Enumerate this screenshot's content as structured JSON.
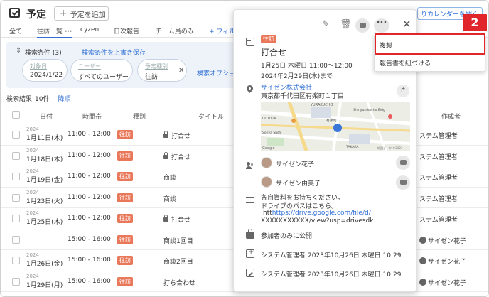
{
  "header": {
    "title": "予定",
    "add_button": "予定を追加",
    "my_calendar_button": "りカレンダーを開く"
  },
  "tabs": [
    {
      "label": "全て"
    },
    {
      "label": "往訪一覧",
      "active": true
    },
    {
      "label": "cyzen"
    },
    {
      "label": "日次報告"
    },
    {
      "label": "チーム員のみ"
    },
    {
      "label": "+ フィル"
    }
  ],
  "conditions": {
    "label": "検索条件 (3)",
    "overwrite": "検索条件を上書き保存",
    "fields": [
      {
        "label": "対象日",
        "value": "2024/1/22"
      },
      {
        "label": "ユーザー",
        "value": "すべてのユーザー"
      },
      {
        "label": "予定種別",
        "value": "往訪"
      }
    ],
    "options": "検索オプショ"
  },
  "results": {
    "label": "検索結果",
    "count": "10件",
    "order": "降順"
  },
  "table": {
    "headers": [
      "日付",
      "時間帯",
      "種別",
      "タイトル",
      "作成者"
    ],
    "rows": [
      {
        "year": "2024",
        "date": "1月11日(木)",
        "time": "11:00 - 12:00",
        "type": "往訪",
        "title": "打合せ",
        "locked": true,
        "creator": "ステム管理者"
      },
      {
        "year": "2024",
        "date": "1月18日(木)",
        "time": "11:00 - 12:00",
        "type": "往訪",
        "title": "打合せ",
        "locked": true,
        "creator": "ステム管理者"
      },
      {
        "year": "2024",
        "date": "1月19日(金)",
        "time": "11:00 - 12:00",
        "type": "往訪",
        "title": "商談",
        "locked": false,
        "creator": "ステム管理者"
      },
      {
        "year": "2024",
        "date": "1月23日(火)",
        "time": "11:00 - 12:00",
        "type": "往訪",
        "title": "商談",
        "locked": false,
        "creator": "ステム管理者"
      },
      {
        "year": "2024",
        "date": "1月25日(木)",
        "time": "11:00 - 12:00",
        "type": "往訪",
        "title": "打合せ",
        "locked": true,
        "creator": "ステム管理者"
      },
      {
        "year": "",
        "date": "",
        "time": "15:00 - 16:00",
        "type": "往訪",
        "title": "商談1回目",
        "locked": false,
        "creator": "サイゼン花子"
      },
      {
        "year": "2024",
        "date": "1月26日(金)",
        "time": "15:00 - 16:00",
        "type": "往訪",
        "title": "商談2回目",
        "locked": false,
        "creator": "サイゼン花子"
      },
      {
        "year": "2024",
        "date": "1月29日(月)",
        "time": "15:00 - 16:00",
        "type": "往訪",
        "title": "打ち合わせ",
        "locked": false,
        "creator": "サイゼン花子"
      }
    ]
  },
  "popup": {
    "badge": "往訪",
    "title": "打合せ",
    "datetime": "1月25日 木曜日 11:00〜12:00",
    "until": "2024年2月29日(木)まで",
    "company": "サイゼン株式会社",
    "address": "東京都千代田区有楽町１丁目",
    "map": {
      "labels": [
        "YURAKUCHO",
        "有楽町",
        "DOTOUR",
        "Sonya Sushi",
        "TAKARA",
        "Google",
        "Shinyurakucho Bldg"
      ],
      "copyright": "地図データ ©2023"
    },
    "participants": [
      "サイゼン花子",
      "サイゼン由美子"
    ],
    "memo": [
      "各自資料をお持ちください。",
      "ドライブのパスはこちら。"
    ],
    "memo_prefix": "htt",
    "memo_link_1": "https://drive.google.com/file/d/",
    "memo_link_2": "XXXXXXXXXXX/view?usp=drivesdk",
    "visibility": "参加者のみに公開",
    "created": {
      "user": "システム管理者",
      "date": "2023年10月26日 木曜日 10:29"
    },
    "updated": {
      "user": "システム管理者",
      "date": "2023年10月26日 木曜日 10:29"
    }
  },
  "menu": {
    "items": [
      "複製",
      "報告書を紐づける"
    ]
  },
  "annotation": {
    "number": "2",
    "color": "#e0262b"
  },
  "colors": {
    "accent": "#2f6fd6",
    "badge": "#e9785a"
  }
}
